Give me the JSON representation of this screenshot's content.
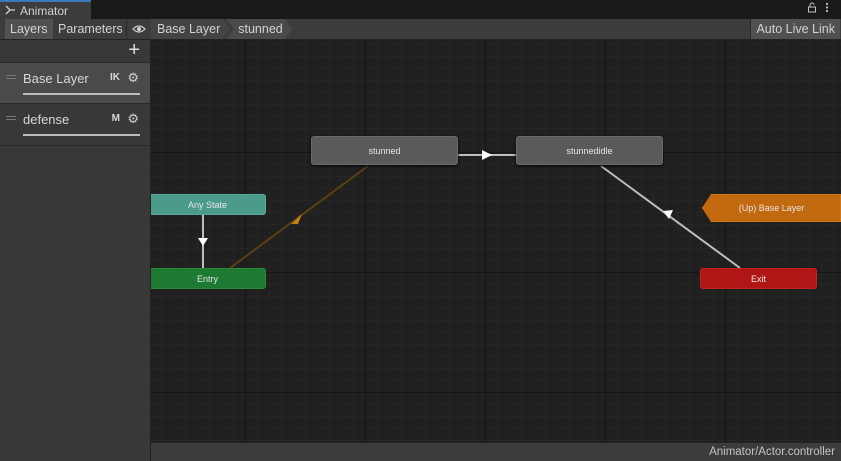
{
  "window": {
    "title": "Animator",
    "tab_icon": "animator-icon",
    "controls": [
      "lock-icon",
      "kebab-menu-icon"
    ]
  },
  "toolbar": {
    "tabs": [
      {
        "label": "Layers",
        "active": true
      },
      {
        "label": "Parameters",
        "active": false
      }
    ],
    "visibility_icon": "eye-icon",
    "breadcrumb": [
      "Base Layer",
      "stunned"
    ],
    "auto_live_link": "Auto Live Link"
  },
  "layers": {
    "add_icon": "plus-icon",
    "items": [
      {
        "name": "Base Layer",
        "flag": "IK",
        "settings_icon": "gear-icon",
        "selected": true
      },
      {
        "name": "defense",
        "flag": "M",
        "settings_icon": "gear-icon",
        "selected": false
      }
    ]
  },
  "graph": {
    "states": [
      {
        "id": "stunned",
        "label": "stunned",
        "kind": "state"
      },
      {
        "id": "stunnedidle",
        "label": "stunnedidle",
        "kind": "state"
      },
      {
        "id": "any",
        "label": "Any State",
        "kind": "any-state"
      },
      {
        "id": "entry",
        "label": "Entry",
        "kind": "entry"
      },
      {
        "id": "up",
        "label": "(Up) Base Layer",
        "kind": "up-state-machine"
      },
      {
        "id": "exit",
        "label": "Exit",
        "kind": "exit"
      }
    ],
    "transitions": [
      {
        "from": "any",
        "to": "entry"
      },
      {
        "from": "entry",
        "to": "stunned",
        "default": true
      },
      {
        "from": "stunned",
        "to": "stunnedidle"
      },
      {
        "from": "stunnedidle",
        "to": "exit"
      }
    ],
    "colors": {
      "state": "#5a5a5a",
      "any_state": "#4b9a8a",
      "entry": "#1e7a33",
      "exit": "#b01616",
      "up": "#c2680e",
      "default_transition": "#6b4a12",
      "transition": "#bdbdbd"
    }
  },
  "status": {
    "path": "Animator/Actor.controller"
  }
}
